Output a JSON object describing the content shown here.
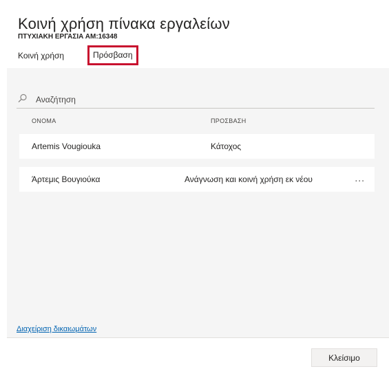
{
  "dialog": {
    "title": "Κοινή χρήση πίνακα εργαλείων",
    "subtitle": "ΠΤΥΧΙΑΚΗ ΕΡΓΑΣΙΑ ΑΜ:16348"
  },
  "tabs": [
    {
      "label": "Κοινή χρήση",
      "selected": false
    },
    {
      "label": "Πρόσβαση",
      "selected": true
    }
  ],
  "search": {
    "placeholder": "Αναζήτηση",
    "icon": "search-icon"
  },
  "table": {
    "columns": [
      "ΟΝΟΜΑ",
      "ΠΡΟΣΒΑΣΗ"
    ],
    "rows": [
      {
        "name": "Artemis Vougiouka",
        "access": "Κάτοχος"
      },
      {
        "name": "Άρτεμις Βουγιούκα",
        "access": "Ανάγνωση και κοινή χρήση εκ νέου",
        "more": "..."
      }
    ]
  },
  "footer": {
    "manage_link": "Διαχείριση δικαιωμάτων",
    "close_label": "Κλείσιμο"
  },
  "colors": {
    "highlight_border": "#c8102e",
    "link": "#0063b1",
    "panel_bg": "#f5f5f5"
  }
}
